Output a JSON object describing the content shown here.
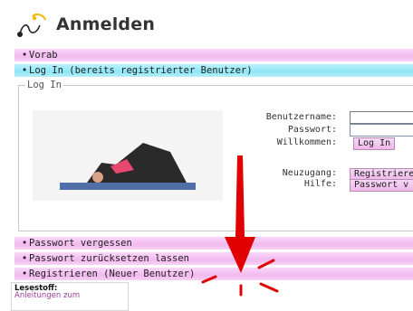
{
  "header": {
    "title": "Anmelden",
    "logo_icon": "spiral-logo-icon"
  },
  "sections": {
    "vorab": "Vorab",
    "login": "Log In (bereits registrierter Benutzer)",
    "pw_forgot": "Passwort vergessen",
    "pw_reset": "Passwort zurücksetzen lassen",
    "register": "Registrieren (Neuer Benutzer)"
  },
  "login_box": {
    "legend": "Log In",
    "username_label": "Benutzername:",
    "password_label": "Passwort:",
    "welcome_label": "Willkommen:",
    "login_button": "Log In",
    "newaccess_label": "Neuzugang:",
    "help_label": "Hilfe:",
    "register_button": "Registrieren",
    "password_button": "Passwort v",
    "image_icon": "yoga-pose-image"
  },
  "reading": {
    "title": "Lesestoff:",
    "link": "Anleitungen zum"
  },
  "colors": {
    "pink_bar": "#f3b9f0",
    "cyan_bar": "#8ee6f6",
    "arrow": "#e00000"
  }
}
